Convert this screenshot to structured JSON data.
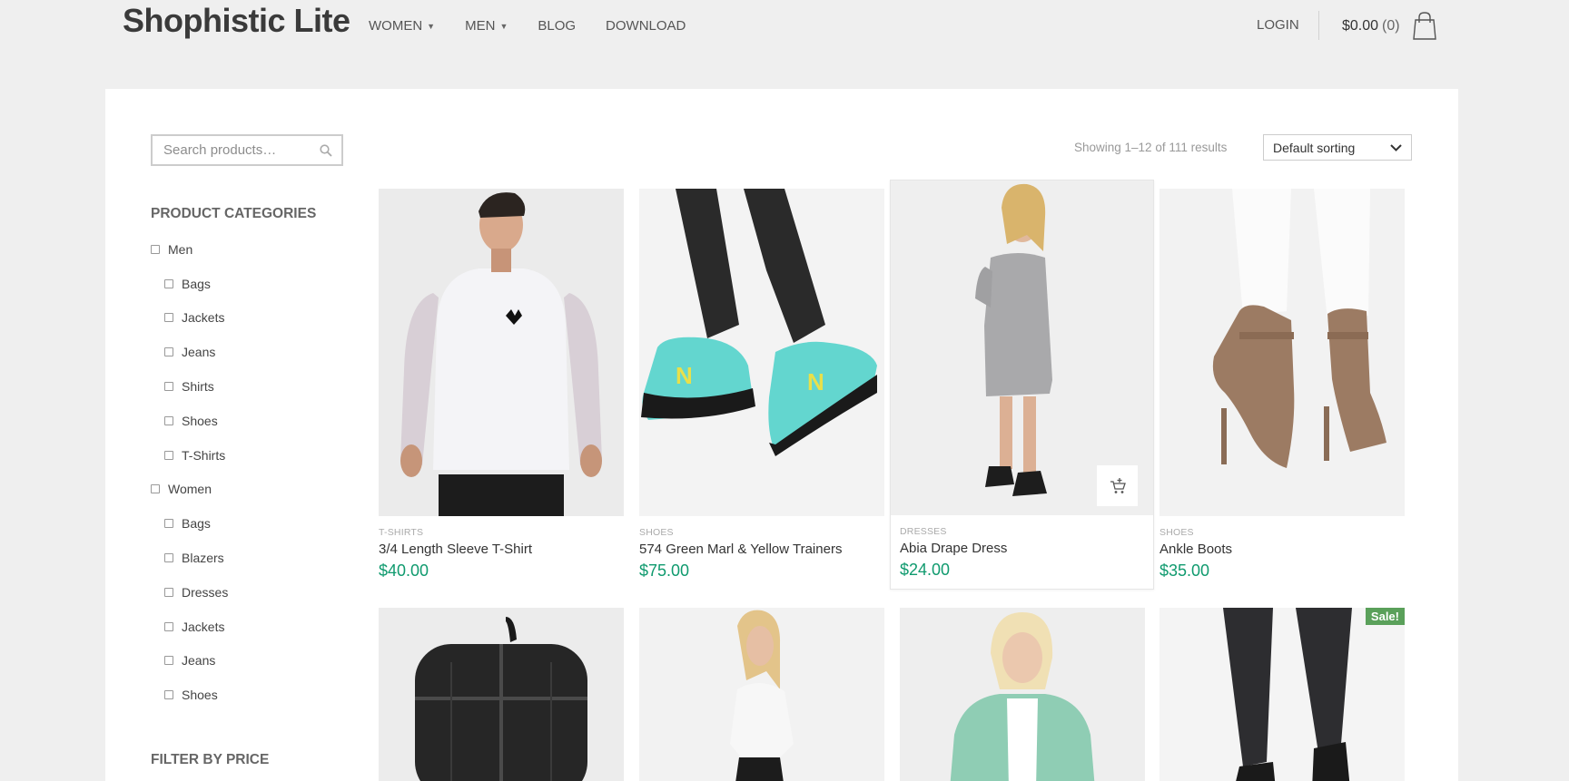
{
  "header": {
    "logo": "Shophistic Lite",
    "nav": [
      {
        "label": "WOMEN",
        "has_dropdown": true
      },
      {
        "label": "MEN",
        "has_dropdown": true
      },
      {
        "label": "BLOG",
        "has_dropdown": false
      },
      {
        "label": "DOWNLOAD",
        "has_dropdown": false
      }
    ],
    "login": "LOGIN",
    "cart_total": "$0.00",
    "cart_count": "(0)"
  },
  "sidebar": {
    "search_placeholder": "Search products…",
    "categories_heading": "PRODUCT CATEGORIES",
    "categories": [
      {
        "label": "Men",
        "level": 0
      },
      {
        "label": "Bags",
        "level": 1
      },
      {
        "label": "Jackets",
        "level": 1
      },
      {
        "label": "Jeans",
        "level": 1
      },
      {
        "label": "Shirts",
        "level": 1
      },
      {
        "label": "Shoes",
        "level": 1
      },
      {
        "label": "T-Shirts",
        "level": 1
      },
      {
        "label": "Women",
        "level": 0
      },
      {
        "label": "Bags",
        "level": 1
      },
      {
        "label": "Blazers",
        "level": 1
      },
      {
        "label": "Dresses",
        "level": 1
      },
      {
        "label": "Jackets",
        "level": 1
      },
      {
        "label": "Jeans",
        "level": 1
      },
      {
        "label": "Shoes",
        "level": 1
      }
    ],
    "price_heading": "FILTER BY PRICE"
  },
  "toolbar": {
    "result_count": "Showing 1–12 of 111 results",
    "sort_selected": "Default sorting"
  },
  "products": [
    {
      "category": "T-SHIRTS",
      "name": "3/4 Length Sleeve T-Shirt",
      "price": "$40.00"
    },
    {
      "category": "SHOES",
      "name": "574 Green Marl & Yellow Trainers",
      "price": "$75.00"
    },
    {
      "category": "DRESSES",
      "name": "Abia Drape Dress",
      "price": "$24.00"
    },
    {
      "category": "SHOES",
      "name": "Ankle Boots",
      "price": "$35.00"
    }
  ],
  "sale_badge": "Sale!",
  "colors": {
    "price": "#0f9a6e",
    "sale_badge": "#5aa05a",
    "background": "#efefef"
  }
}
